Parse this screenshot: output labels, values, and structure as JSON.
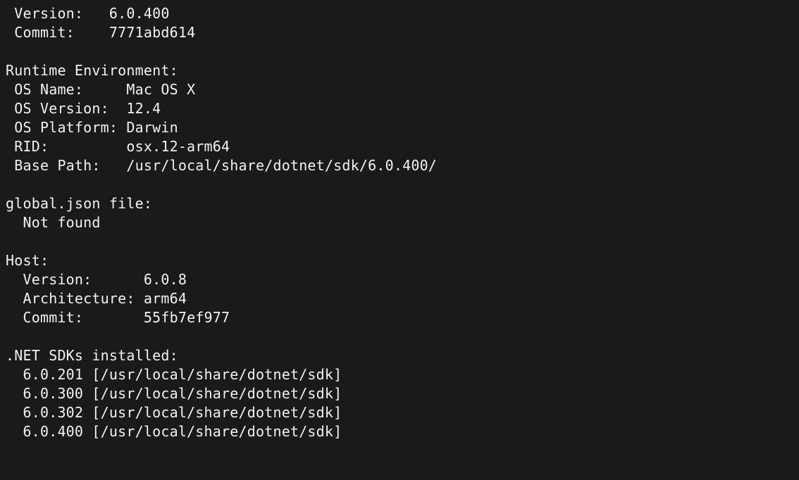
{
  "sdk": {
    "version_label": " Version:   ",
    "version": "6.0.400",
    "commit_label": " Commit:    ",
    "commit": "7771abd614"
  },
  "runtime_env": {
    "header": "Runtime Environment:",
    "os_name_label": " OS Name:     ",
    "os_name": "Mac OS X",
    "os_version_label": " OS Version:  ",
    "os_version": "12.4",
    "os_platform_label": " OS Platform: ",
    "os_platform": "Darwin",
    "rid_label": " RID:         ",
    "rid": "osx.12-arm64",
    "base_path_label": " Base Path:   ",
    "base_path": "/usr/local/share/dotnet/sdk/6.0.400/"
  },
  "global_json": {
    "header": "global.json file:",
    "status": "  Not found"
  },
  "host": {
    "header": "Host:",
    "version_label": "  Version:      ",
    "version": "6.0.8",
    "arch_label": "  Architecture: ",
    "arch": "arm64",
    "commit_label": "  Commit:       ",
    "commit": "55fb7ef977"
  },
  "sdks": {
    "header": ".NET SDKs installed:",
    "items": [
      "  6.0.201 [/usr/local/share/dotnet/sdk]",
      "  6.0.300 [/usr/local/share/dotnet/sdk]",
      "  6.0.302 [/usr/local/share/dotnet/sdk]",
      "  6.0.400 [/usr/local/share/dotnet/sdk]"
    ]
  }
}
